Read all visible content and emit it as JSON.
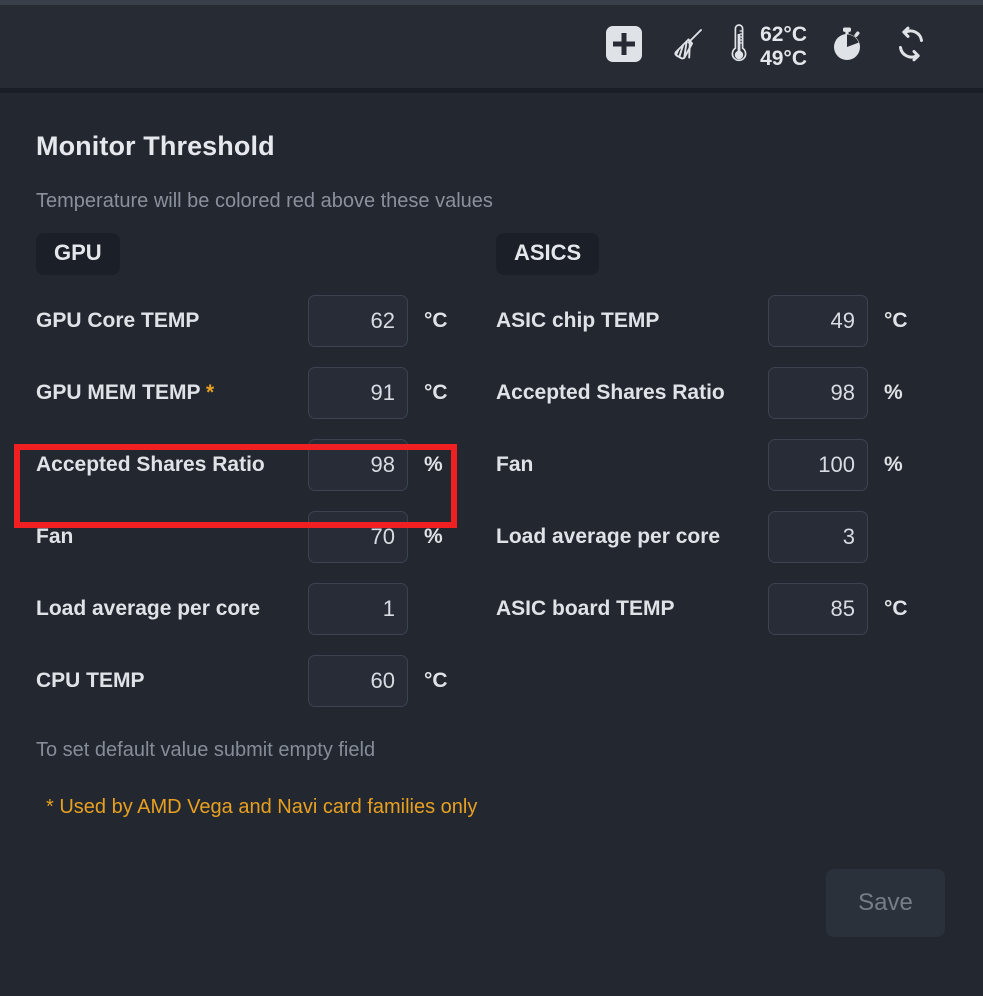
{
  "toolbar": {
    "add_label": "add-icon",
    "clean_label": "broom-icon",
    "thermometer_label": "thermometer-icon",
    "temp_gpu": "62°C",
    "temp_asic": "49°C",
    "timer_label": "stopwatch-icon",
    "refresh_label": "refresh-icon"
  },
  "page": {
    "title": "Monitor Threshold",
    "subtitle": "Temperature will be colored red above these values",
    "footnote": "To set default value submit empty field",
    "footnote_warning": "* Used by AMD Vega and Navi card families only",
    "save_label": "Save"
  },
  "colors": {
    "highlight": "#f01f22",
    "accent_warning": "#e8a020",
    "background": "#23272f",
    "toolbar": "#272b33"
  },
  "gpu": {
    "badge": "GPU",
    "fields": [
      {
        "label": "GPU Core TEMP",
        "star": "",
        "value": "62",
        "unit": "°C"
      },
      {
        "label": "GPU MEM TEMP ",
        "star": "*",
        "value": "91",
        "unit": "°C"
      },
      {
        "label": "Accepted Shares Ratio",
        "star": "",
        "value": "98",
        "unit": "%"
      },
      {
        "label": "Fan",
        "star": "",
        "value": "70",
        "unit": "%"
      },
      {
        "label": "Load average per core",
        "star": "",
        "value": "1",
        "unit": ""
      },
      {
        "label": "CPU TEMP",
        "star": "",
        "value": "60",
        "unit": "°C"
      }
    ]
  },
  "asics": {
    "badge": "ASICS",
    "fields": [
      {
        "label": "ASIC chip TEMP",
        "star": "",
        "value": "49",
        "unit": "°C"
      },
      {
        "label": "Accepted Shares Ratio",
        "star": "",
        "value": "98",
        "unit": "%"
      },
      {
        "label": "Fan",
        "star": "",
        "value": "100",
        "unit": "%"
      },
      {
        "label": "Load average per core",
        "star": "",
        "value": "3",
        "unit": ""
      },
      {
        "label": "ASIC board TEMP",
        "star": "",
        "value": "85",
        "unit": "°C"
      }
    ]
  }
}
